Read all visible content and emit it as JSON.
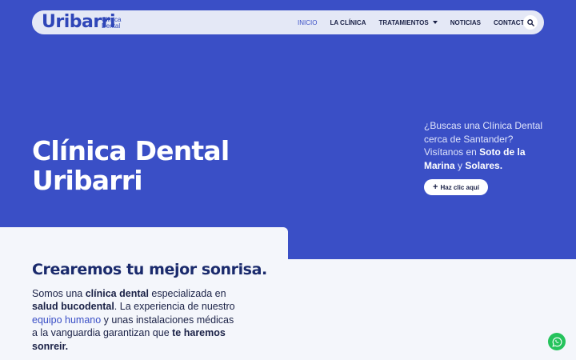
{
  "brand": {
    "name": "Uribarri",
    "sub_line1": "Clínica",
    "sub_line2": "Dental"
  },
  "nav": {
    "items": [
      {
        "label": "INICIO",
        "active": true
      },
      {
        "label": "LA CLÍNICA"
      },
      {
        "label": "TRATAMIENTOS",
        "has_dropdown": true
      },
      {
        "label": "NOTICIAS"
      },
      {
        "label": "CONTACTO"
      }
    ],
    "search_icon": "search-icon"
  },
  "hero": {
    "title_line1": "Clínica Dental",
    "title_line2": "Uribarri",
    "side_line1": "¿Buscas una Clínica Dental",
    "side_line2": "cerca de Santander?",
    "side_line3a": "Visítanos en ",
    "side_line3b": "Soto de la",
    "side_line4a": "Marina",
    "side_line4b": " y ",
    "side_line4c": "Solares.",
    "cta_label": "Haz clic aquí"
  },
  "intro": {
    "title": "Crearemos tu mejor sonrisa.",
    "p1": "Somos una ",
    "p2": "clínica dental",
    "p3": " especializada en",
    "p4": "salud bucodental",
    "p5": ". La experiencia de nuestro",
    "p6": "equipo humano",
    "p7": " y unas instalaciones médicas",
    "p8": "a la vanguardia garantizan que ",
    "p9": "te haremos",
    "p10": "sonreir."
  },
  "colors": {
    "hero_bg": "#3a4fc6",
    "nav_bg": "#e4e8f6",
    "text_dark": "#1a2146",
    "whatsapp": "#25c35c"
  }
}
